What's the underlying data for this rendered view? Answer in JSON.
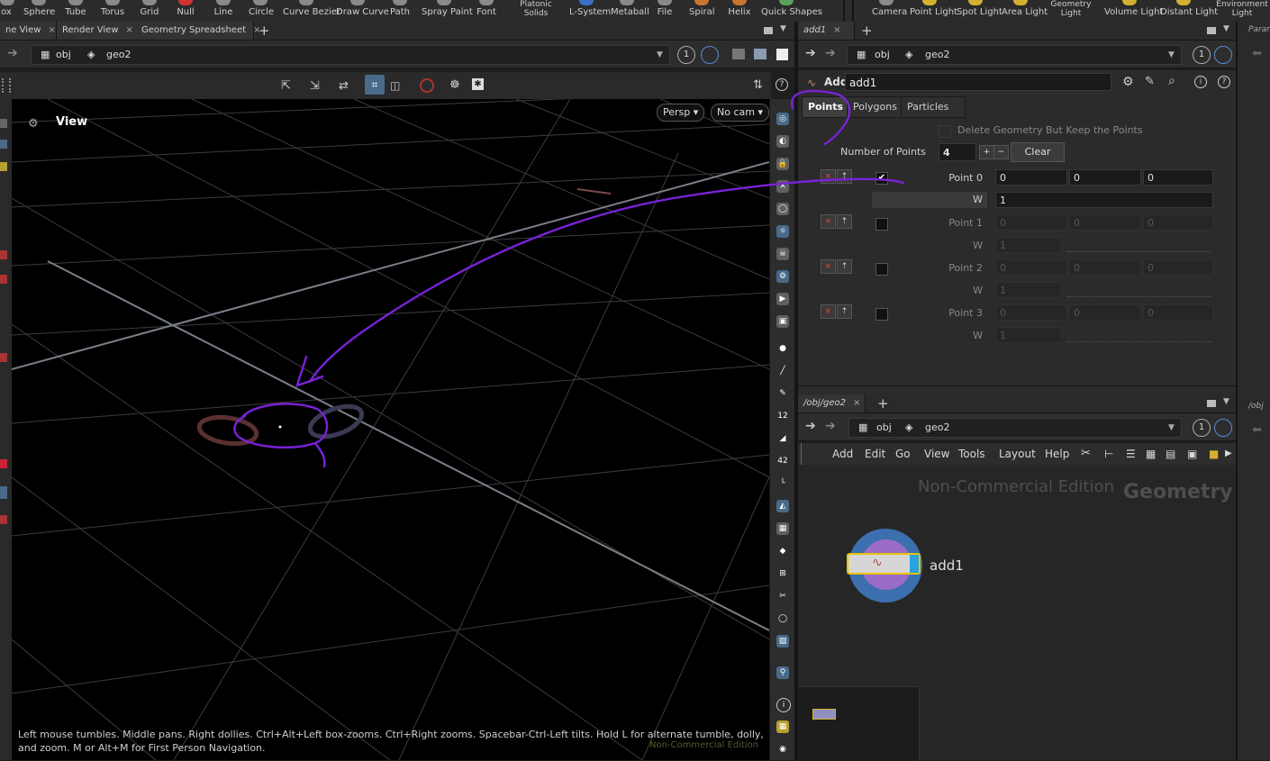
{
  "shelf": {
    "tools": [
      "ox",
      "Sphere",
      "Tube",
      "Torus",
      "Grid",
      "Null",
      "Line",
      "Circle",
      "Curve Bezier",
      "Draw Curve",
      "Path",
      "Spray Paint",
      "Font",
      "Platonic Solids",
      "L-System",
      "Metaball",
      "File",
      "Spiral",
      "Helix",
      "Quick Shapes"
    ],
    "lights": [
      "Camera",
      "Point Light",
      "Spot Light",
      "Area Light",
      "Geometry Light",
      "Volume Light",
      "Distant Light",
      "Environment Light"
    ]
  },
  "viewer_tabs": [
    {
      "label": "ne View",
      "close": "×"
    },
    {
      "label": "Render View",
      "close": "×"
    },
    {
      "label": "Geometry Spreadsheet",
      "close": "×"
    }
  ],
  "params_tab": {
    "label": "add1",
    "close": "×"
  },
  "params_right_tab": "Paran",
  "path": {
    "level1": "obj",
    "level2": "geo2",
    "badge": "1"
  },
  "viewport": {
    "title": "View",
    "persp": "Persp",
    "cam": "No cam",
    "status_text": "Left mouse tumbles. Middle pans. Right dollies. Ctrl+Alt+Left box-zooms. Ctrl+Right zooms. Spacebar-Ctrl-Left tilts. Hold L for alternate tumble, dolly, and zoom. M or Alt+M for First Person Navigation.",
    "watermark": "Non-Commercial Edition"
  },
  "params": {
    "node_type": "Add",
    "node_name": "add1",
    "tabs": [
      "Points",
      "Polygons",
      "Particles"
    ],
    "delete_geo_label": "Delete Geometry But Keep the Points",
    "num_points_label": "Number of Points",
    "num_points_value": "4",
    "plus": "+",
    "minus": "−",
    "clear": "Clear",
    "points": [
      {
        "label": "Point 0",
        "x": "0",
        "y": "0",
        "z": "0",
        "w_label": "W",
        "w": "1",
        "checked": true
      },
      {
        "label": "Point 1",
        "x": "0",
        "y": "0",
        "z": "0",
        "w_label": "W",
        "w": "1",
        "checked": false
      },
      {
        "label": "Point 2",
        "x": "0",
        "y": "0",
        "z": "0",
        "w_label": "W",
        "w": "1",
        "checked": false
      },
      {
        "label": "Point 3",
        "x": "0",
        "y": "0",
        "z": "0",
        "w_label": "W",
        "w": "1",
        "checked": false
      }
    ]
  },
  "network": {
    "tab": "/obj/geo2",
    "close": "×",
    "right_tab": "/obj",
    "menu": [
      "Add",
      "Edit",
      "Go",
      "View",
      "Tools",
      "Layout",
      "Help"
    ],
    "watermark": "Non-Commercial Edition",
    "context": "Geometry",
    "node_label": "add1"
  },
  "colors": {
    "annotation": "#7a22d9",
    "node_yellow": "#e6c400",
    "node_blue": "#29a3e0",
    "selected_tab": "#3e3e3e"
  }
}
